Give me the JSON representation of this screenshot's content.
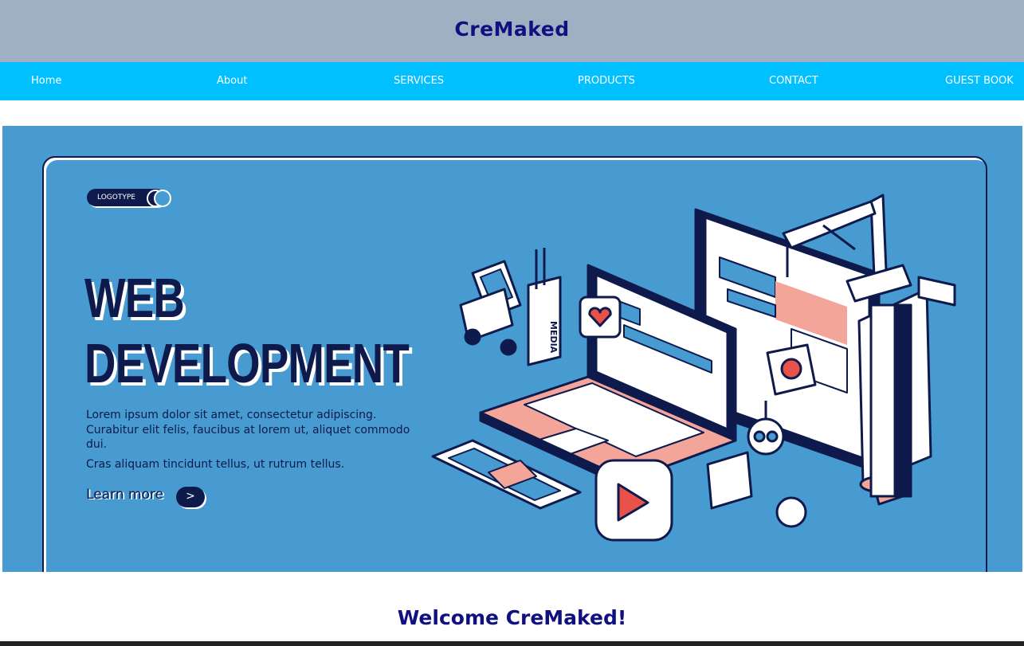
{
  "header": {
    "brand": "CreMaked"
  },
  "nav": {
    "items": [
      {
        "label": "Home"
      },
      {
        "label": "About"
      },
      {
        "label": "SERVICES"
      },
      {
        "label": "PRODUCTS"
      },
      {
        "label": "CONTACT"
      },
      {
        "label": "GUEST BOOK"
      }
    ]
  },
  "hero": {
    "logotype": "LOGOTYPE",
    "headline_line1": "WEB",
    "headline_line2": "DEVELOPMENT",
    "para1": "Lorem ipsum dolor sit amet, consectetur adipiscing. Curabitur elit felis, faucibus at lorem ut, aliquet commodo dui.",
    "para2": "Cras aliquam tincidunt tellus, ut rutrum tellus.",
    "learn_more": "Learn more",
    "arrow": ">",
    "media_label": "MEDIA",
    "colors": {
      "background": "#479bd1",
      "navy": "#0e1a4c",
      "salmon": "#f4a59a",
      "red": "#e8524a"
    }
  },
  "main": {
    "welcome": "Welcome CreMaked!"
  },
  "colors": {
    "topbar": "#9fb0c3",
    "nav": "#00c0ff",
    "brand_text": "#101080"
  }
}
